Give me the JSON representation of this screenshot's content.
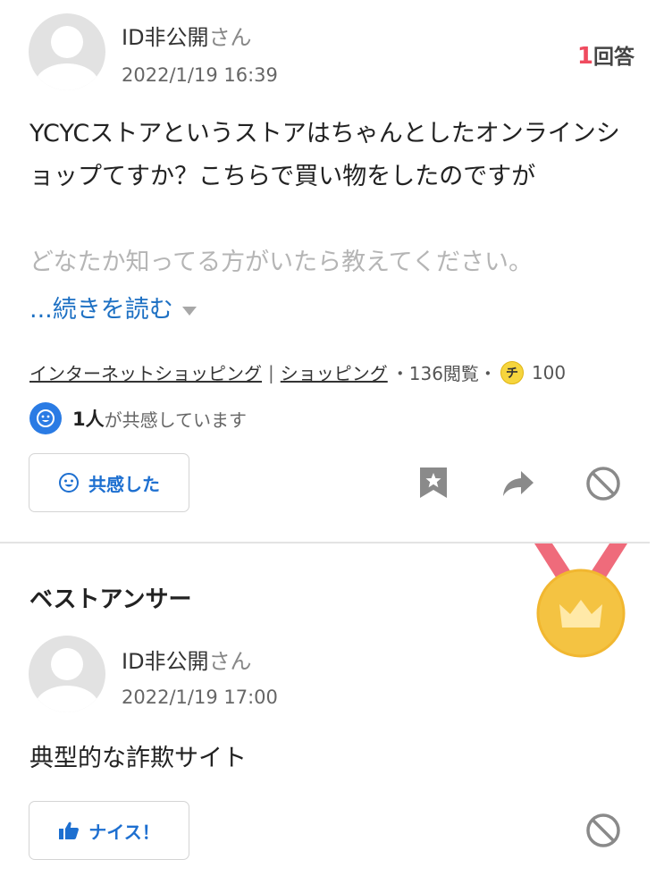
{
  "question": {
    "user": {
      "name": "ID非公開",
      "suffix": "さん",
      "date": "2022/1/19 16:39"
    },
    "answer_count": {
      "num": "1",
      "label": "回答"
    },
    "text_visible": "YCYCストアというストアはちゃんとしたオンラインショップてすか？こちらで買い物をしたのですが",
    "text_faded": "どなたか知ってる方がいたら教えてください。",
    "read_more_label": "...続きを読む",
    "meta": {
      "category1": "インターネットショッピング",
      "separator": "|",
      "category2": "ショッピング",
      "views": "・136閲覧・",
      "coin_symbol": "チ",
      "coins": "100"
    },
    "empathy": {
      "count": "1人",
      "text": "が共感しています"
    },
    "empathize_button_label": "共感した"
  },
  "best_answer": {
    "title": "ベストアンサー",
    "user": {
      "name": "ID非公開",
      "suffix": "さん",
      "date": "2022/1/19 17:00"
    },
    "text": "典型的な詐欺サイト",
    "nice_button_label": "ナイス！"
  },
  "colors": {
    "accent_blue": "#1d6fd0",
    "answer_count_red": "#ef4b5f",
    "medal_gold": "#f4c342",
    "ribbon_red": "#ef6b7b"
  },
  "icons": [
    "avatar-icon",
    "smile-icon",
    "bookmark-star-icon",
    "share-arrow-icon",
    "block-icon",
    "thumbs-up-icon",
    "medal-crown-icon",
    "coin-icon"
  ]
}
